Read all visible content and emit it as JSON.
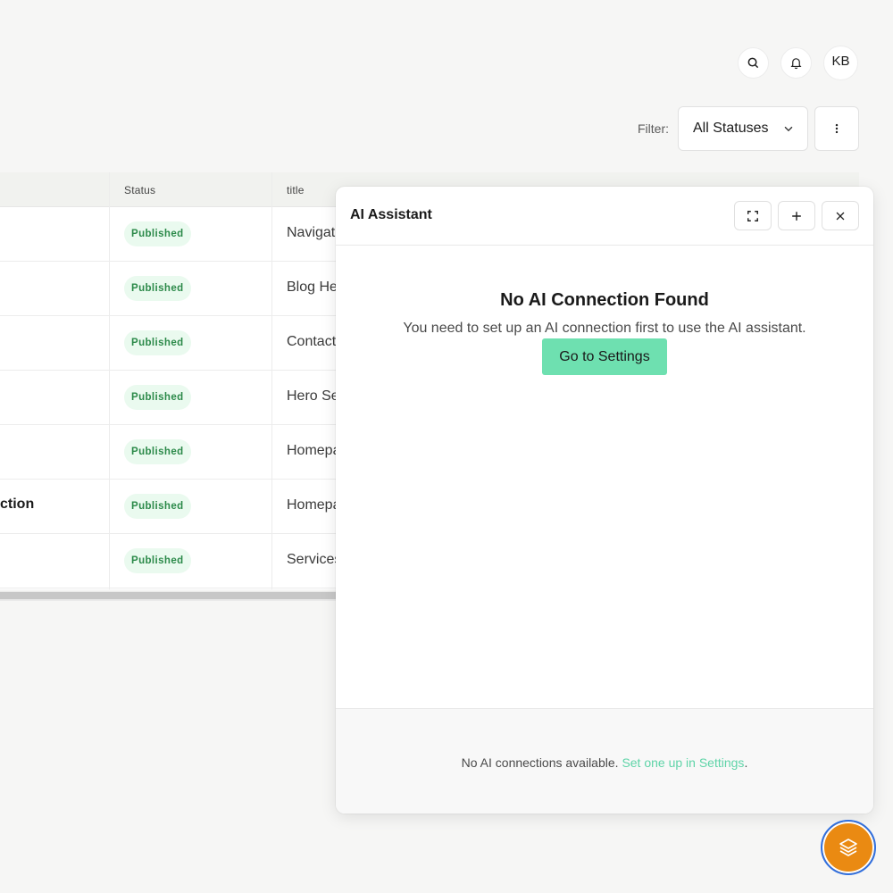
{
  "header": {
    "search_icon": "search-icon",
    "notification_icon": "bell-icon",
    "avatar_initials": "KB"
  },
  "filter": {
    "label": "Filter:",
    "selected": "All Statuses",
    "more_icon": "vertical-dots-icon"
  },
  "table": {
    "columns": [
      "Status",
      "title"
    ],
    "rows": [
      {
        "name": "",
        "status": "Published",
        "title": "Navigat"
      },
      {
        "name": "",
        "status": "Published",
        "title": "Blog He"
      },
      {
        "name": "",
        "status": "Published",
        "title": "Contact"
      },
      {
        "name": "",
        "status": "Published",
        "title": "Hero Se"
      },
      {
        "name": "",
        "status": "Published",
        "title": "Homepa"
      },
      {
        "name": "ction",
        "status": "Published",
        "title": "Homepa"
      },
      {
        "name": "",
        "status": "Published",
        "title": "Services"
      }
    ]
  },
  "assistant": {
    "title": "AI Assistant",
    "expand_icon": "expand-icon",
    "new_icon": "plus-icon",
    "close_icon": "close-icon",
    "empty_title": "No AI Connection Found",
    "empty_text": "You need to set up an AI connection first to use the AI assistant.",
    "settings_button": "Go to Settings",
    "footer_text": "No AI connections available.",
    "footer_link": "Set one up in Settings",
    "footer_suffix": ".",
    "accent": "#6ee0b0"
  },
  "fab": {
    "icon": "layers-icon",
    "color": "#ea8a12"
  },
  "colors": {
    "badge_bg": "#eafaef",
    "badge_text": "#2c8a4a"
  }
}
